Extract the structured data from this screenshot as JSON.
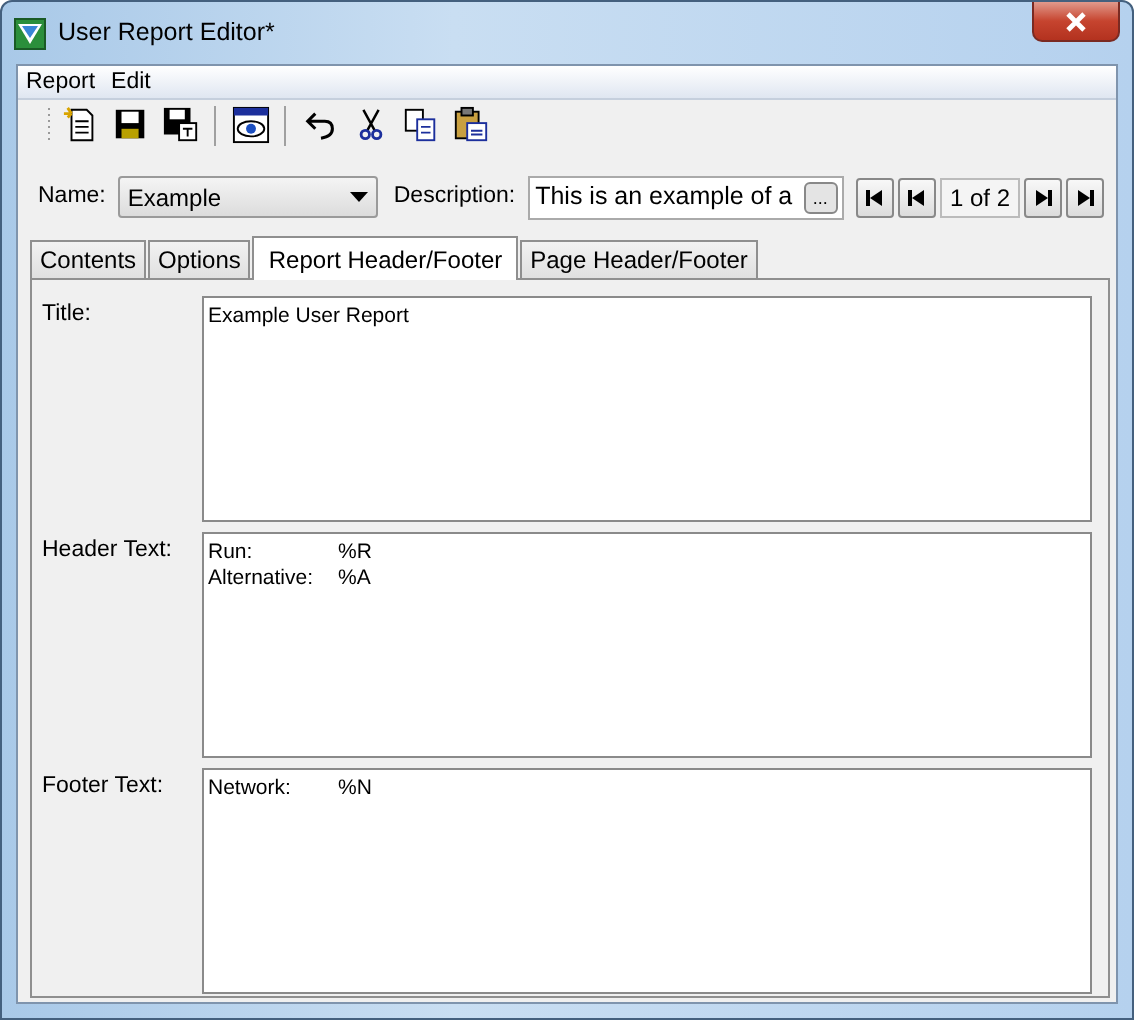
{
  "window": {
    "title": "User Report Editor*"
  },
  "menu": [
    "Report",
    "Edit"
  ],
  "toolbar": [
    {
      "kind": "new"
    },
    {
      "kind": "save"
    },
    {
      "kind": "saveas"
    },
    {
      "kind": "sep"
    },
    {
      "kind": "preview"
    },
    {
      "kind": "sep"
    },
    {
      "kind": "undo"
    },
    {
      "kind": "cut"
    },
    {
      "kind": "copy"
    },
    {
      "kind": "paste"
    }
  ],
  "name_field": {
    "label": "Name:",
    "value": "Example"
  },
  "description_field": {
    "label": "Description:",
    "value": "This is an example of a",
    "button": "..."
  },
  "pager": {
    "position": "1 of 2"
  },
  "tabs": [
    {
      "label": "Contents",
      "selected": false
    },
    {
      "label": "Options",
      "selected": false
    },
    {
      "label": "Report Header/Footer",
      "selected": true
    },
    {
      "label": "Page Header/Footer",
      "selected": false
    }
  ],
  "sections": [
    {
      "label": "Title:",
      "lines": [
        "Example User Report"
      ]
    },
    {
      "label": "Header Text:",
      "lines": [
        "Run:\t%R",
        "Alternative:\t%A"
      ]
    },
    {
      "label": "Footer Text:",
      "lines": [
        "Network:\t%N"
      ]
    }
  ]
}
